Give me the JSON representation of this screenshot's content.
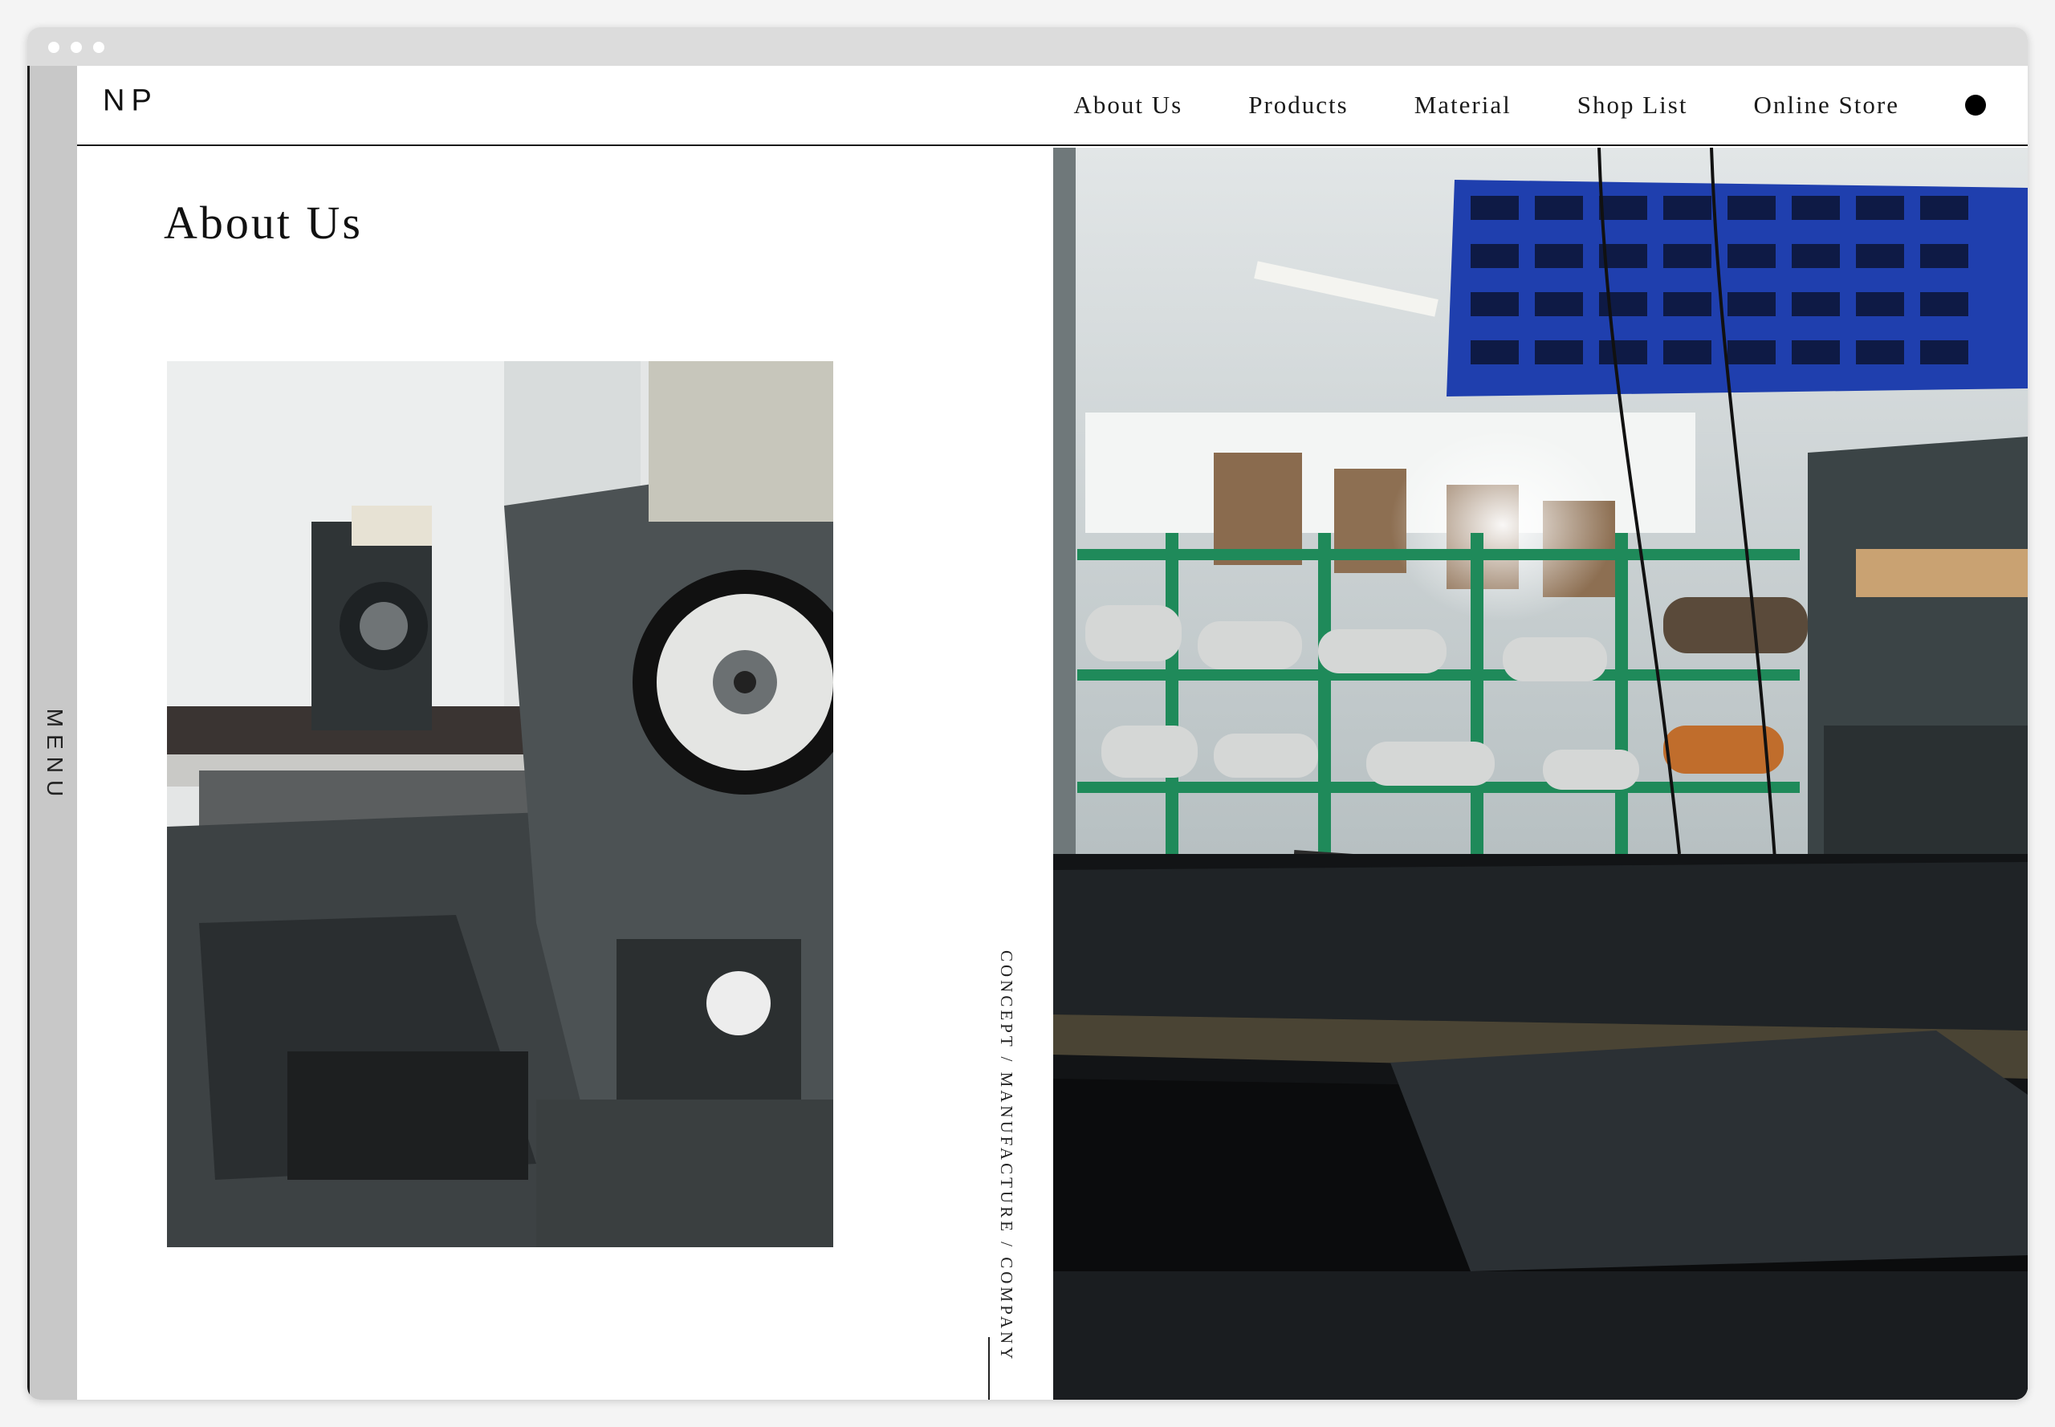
{
  "sidebar": {
    "menu_label": "MENU"
  },
  "header": {
    "logo": "NP",
    "nav": [
      {
        "label": "About Us"
      },
      {
        "label": "Products"
      },
      {
        "label": "Material"
      },
      {
        "label": "Shop List"
      },
      {
        "label": "Online Store"
      }
    ]
  },
  "main": {
    "title": "About Us",
    "side_nav": "CONCEPT  /  MANUFACTURE  /  COMPANY"
  }
}
